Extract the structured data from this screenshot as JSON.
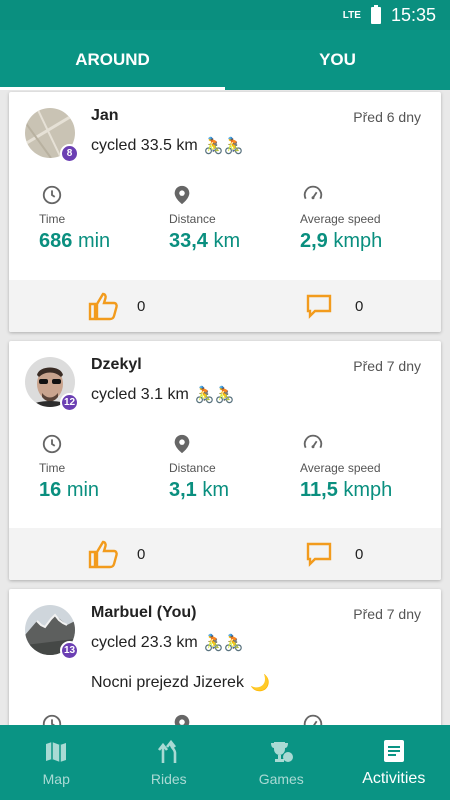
{
  "status": {
    "network": "LTE",
    "time": "15:35"
  },
  "tabs": [
    {
      "label": "AROUND"
    },
    {
      "label": "YOU"
    }
  ],
  "activities": [
    {
      "name": "Jan",
      "level": "8",
      "when": "Před 6 dny",
      "text": "cycled 33.5 km",
      "emoji": "🚴🚴",
      "stats": {
        "time": {
          "label": "Time",
          "value": "686",
          "unit": "min"
        },
        "distance": {
          "label": "Distance",
          "value": "33,4",
          "unit": "km"
        },
        "speed": {
          "label": "Average speed",
          "value": "2,9",
          "unit": "kmph"
        }
      },
      "likes": "0",
      "comments": "0"
    },
    {
      "name": "Dzekyl",
      "level": "12",
      "when": "Před 7 dny",
      "text": "cycled 3.1 km",
      "emoji": "🚴🚴",
      "stats": {
        "time": {
          "label": "Time",
          "value": "16",
          "unit": "min"
        },
        "distance": {
          "label": "Distance",
          "value": "3,1",
          "unit": "km"
        },
        "speed": {
          "label": "Average speed",
          "value": "11,5",
          "unit": "kmph"
        }
      },
      "likes": "0",
      "comments": "0"
    },
    {
      "name": "Marbuel (You)",
      "level": "13",
      "when": "Před 7 dny",
      "text": "cycled 23.3 km",
      "emoji": "🚴🚴",
      "note": "Nocni prejezd Jizerek",
      "note_emoji": "🌙"
    }
  ],
  "nav": [
    {
      "label": "Map"
    },
    {
      "label": "Rides"
    },
    {
      "label": "Games"
    },
    {
      "label": "Activities"
    }
  ],
  "colors": {
    "primary": "#0a9484",
    "accent": "#f29b1d",
    "badge": "#6b3fb3"
  }
}
